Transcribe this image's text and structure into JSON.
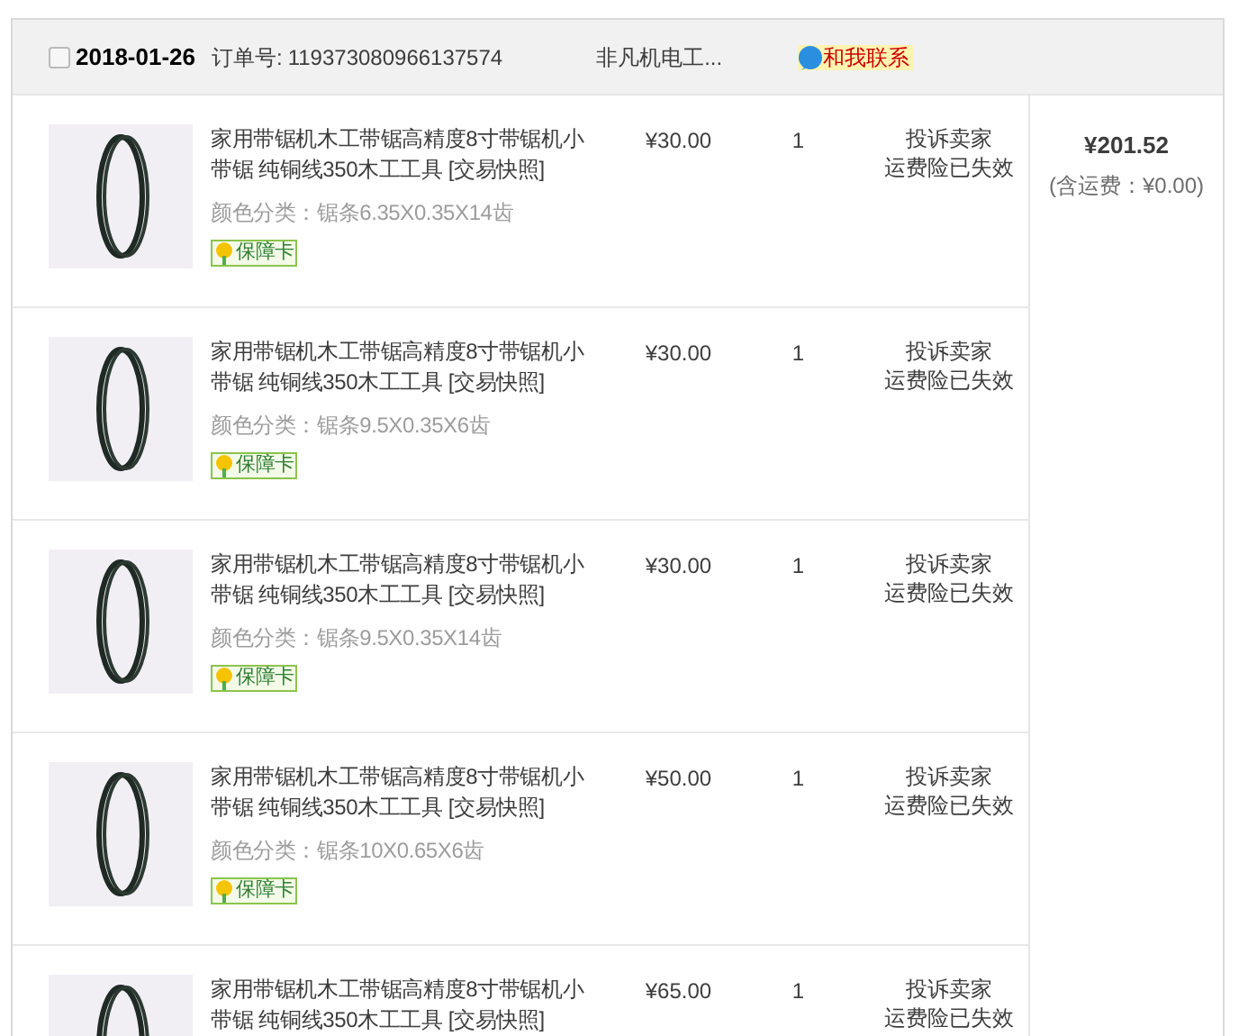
{
  "order": {
    "checked": false,
    "date": "2018-01-26",
    "order_no_label": "订单号:",
    "order_no": "119373080966137574",
    "shop": "非凡机电工...",
    "contact": "和我联系"
  },
  "items": [
    {
      "title": "家用带锯机木工带锯高精度8寸带锯机小带锯 纯铜线350木工工具 [交易快照]",
      "spec": "颜色分类：锯条6.35X0.35X14齿",
      "badge": "保障卡",
      "price": "¥30.00",
      "qty": "1",
      "actions": [
        "投诉卖家",
        "运费险已失效"
      ]
    },
    {
      "title": "家用带锯机木工带锯高精度8寸带锯机小带锯 纯铜线350木工工具 [交易快照]",
      "spec": "颜色分类：锯条9.5X0.35X6齿",
      "badge": "保障卡",
      "price": "¥30.00",
      "qty": "1",
      "actions": [
        "投诉卖家",
        "运费险已失效"
      ]
    },
    {
      "title": "家用带锯机木工带锯高精度8寸带锯机小带锯 纯铜线350木工工具 [交易快照]",
      "spec": "颜色分类：锯条9.5X0.35X14齿",
      "badge": "保障卡",
      "price": "¥30.00",
      "qty": "1",
      "actions": [
        "投诉卖家",
        "运费险已失效"
      ]
    },
    {
      "title": "家用带锯机木工带锯高精度8寸带锯机小带锯 纯铜线350木工工具 [交易快照]",
      "spec": "颜色分类：锯条10X0.65X6齿",
      "badge": "保障卡",
      "price": "¥50.00",
      "qty": "1",
      "actions": [
        "投诉卖家",
        "运费险已失效"
      ]
    },
    {
      "title": "家用带锯机木工带锯高精度8寸带锯机小带锯 纯铜线350木工工具 [交易快照]",
      "price": "¥65.00",
      "qty": "1",
      "actions": [
        "投诉卖家",
        "运费险已失效"
      ]
    }
  ],
  "total": {
    "amount": "¥201.52",
    "shipping": "(含运费：¥0.00)"
  }
}
